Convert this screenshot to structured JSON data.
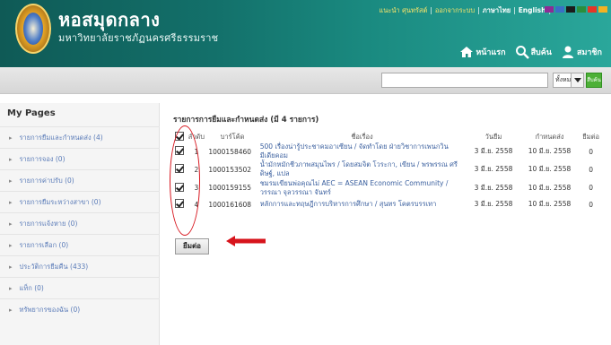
{
  "header": {
    "site_title": "หอสมุดกลาง",
    "site_subtitle": "มหาวิทยาลัยราชภัฏนครศรีธรรมราช",
    "top_links": {
      "user": "แนะนำ ศุนทรัสต์",
      "logout": "ออกจากระบบ",
      "lang_th": "ภาษาไทย",
      "lang_en": "English"
    },
    "swatch_colors": [
      "#8d2b95",
      "#3a6fc6",
      "#1b1b1b",
      "#2a8f3c",
      "#e63526",
      "#f4b223"
    ],
    "nav": [
      {
        "label": "หน้าแรก",
        "icon": "home-icon"
      },
      {
        "label": "สืบค้น",
        "icon": "search-icon"
      },
      {
        "label": "สมาชิก",
        "icon": "user-icon"
      }
    ]
  },
  "search": {
    "value": "",
    "scope": "ทั้งหมด",
    "button": "สืบค้น"
  },
  "sidebar": {
    "title": "My Pages",
    "items": [
      {
        "label": "รายการยืมและกำหนดส่ง (4)"
      },
      {
        "label": "รายการจอง (0)"
      },
      {
        "label": "รายการค่าปรับ (0)"
      },
      {
        "label": "รายการยืมระหว่างสาขา (0)"
      },
      {
        "label": "รายการแจ้งหาย (0)"
      },
      {
        "label": "รายการเลือก (0)"
      },
      {
        "label": "ประวัติการยืมคืน (433)"
      },
      {
        "label": "แท็ก (0)"
      },
      {
        "label": "ทรัพยากรของฉัน (0)"
      }
    ]
  },
  "main": {
    "title": "รายการการยืมและกำหนดส่ง (มี 4 รายการ)",
    "columns": {
      "no": "ลำดับ",
      "barcode": "บาร์โค้ด",
      "title": "ชื่อเรื่อง",
      "loan_date": "วันยืม",
      "due_date": "กำหนดส่ง",
      "renewals": "ยืมต่อ"
    },
    "rows": [
      {
        "no": "1",
        "barcode": "1000158460",
        "title": "500 เรื่องน่ารู้ประชาคมอาเซียน / จัดทำโดย ฝ่ายวิชาการเพนกวิน มีเดียคอม",
        "loan_date": "3 มี.ย. 2558",
        "due_date": "10 มี.ย. 2558",
        "renewals": "0"
      },
      {
        "no": "2",
        "barcode": "1000153502",
        "title": "น้ำมักหมักชีวภาพสมุนไพร / โดยสมจิต โวระกา, เขียน / พรพรรณ ศรีดิษฐ์, แปล",
        "loan_date": "3 มี.ย. 2558",
        "due_date": "10 มี.ย. 2558",
        "renewals": "0"
      },
      {
        "no": "3",
        "barcode": "1000159155",
        "title": "ชมรมเขียนพ่อคุณไม่ AEC = ASEAN Economic Community / วรรณา จุลวรรณา จันทร์",
        "loan_date": "3 มี.ย. 2558",
        "due_date": "10 มี.ย. 2558",
        "renewals": "0"
      },
      {
        "no": "4",
        "barcode": "1000161608",
        "title": "หลักการและทฤษฎีการบริหารการศึกษา / สุนทร โคตรบรรเทา",
        "loan_date": "3 มี.ย. 2558",
        "due_date": "10 มี.ย. 2558",
        "renewals": "0"
      }
    ],
    "renew_button": "ยืมต่อ"
  },
  "annotations": {
    "highlight_color": "#d7141c"
  }
}
